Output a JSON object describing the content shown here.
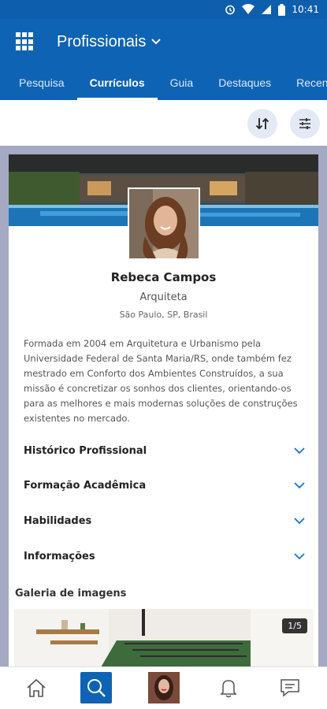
{
  "status": {
    "time": "10:41"
  },
  "app": {
    "title": "Profissionais"
  },
  "tabs": [
    {
      "label": "Pesquisa",
      "active": false
    },
    {
      "label": "Currículos",
      "active": true
    },
    {
      "label": "Guia",
      "active": false
    },
    {
      "label": "Destaques",
      "active": false
    },
    {
      "label": "Recentes",
      "active": false
    }
  ],
  "profile": {
    "name": "Rebeca Campos",
    "role": "Arquiteta",
    "location": "São Paulo, SP, Brasil",
    "bio": "Formada em 2004 em Arquitetura e Urbanismo pela Universidade Federal de Santa Maria/RS, onde também fez mestrado em Conforto dos Ambientes Construídos, a sua missão é concretizar os sonhos dos clientes, orientando-os para as melhores e mais modernas soluções de construções existentes no mercado."
  },
  "sections": [
    {
      "label": "Histórico Profissional"
    },
    {
      "label": "Formação Acadêmica"
    },
    {
      "label": "Habilidades"
    },
    {
      "label": "Informações"
    }
  ],
  "gallery": {
    "title": "Galeria de imagens",
    "counter": "1/5"
  },
  "colors": {
    "primary": "#0f63b5",
    "background": "#a6a9c4",
    "chevron": "#1a73c8"
  },
  "icons": [
    "apps-grid-icon",
    "chevron-down-icon",
    "sort-icon",
    "filter-icon",
    "home-icon",
    "search-icon",
    "bell-icon",
    "chat-icon"
  ]
}
